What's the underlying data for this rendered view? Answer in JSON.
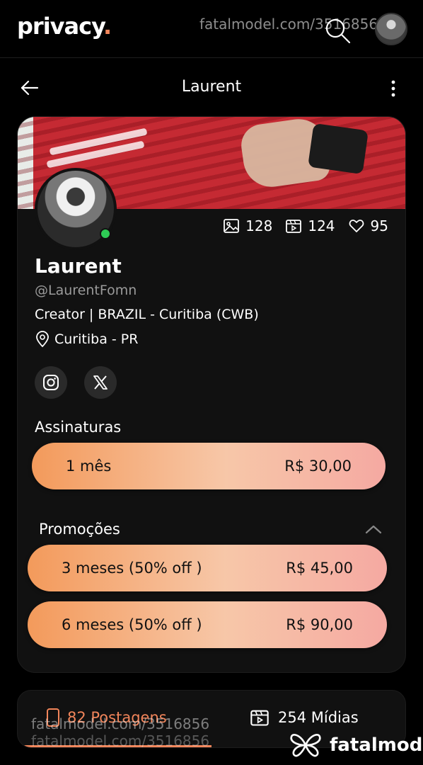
{
  "header": {
    "logo": "privacy",
    "logo_dot": ".",
    "watermark": "fatalmodel.com/3516856"
  },
  "nav": {
    "title": "Laurent"
  },
  "profile": {
    "name": "Laurent",
    "handle": "@LaurentFomn",
    "bio": "Creator | BRAZIL - Curitiba (CWB)",
    "location": "Curitiba - PR",
    "online_status_color": "#2ecc55"
  },
  "stats": {
    "images": "128",
    "videos": "124",
    "likes": "95"
  },
  "social": {
    "instagram_icon": "instagram-icon",
    "x_icon": "x-icon"
  },
  "subscriptions": {
    "title": "Assinaturas",
    "plans": [
      {
        "label": "1 mês",
        "price": "R$ 30,00"
      }
    ]
  },
  "promotions": {
    "title": "Promoções",
    "plans": [
      {
        "label": "3 meses (50% off )",
        "price": "R$ 45,00"
      },
      {
        "label": "6 meses (50% off )",
        "price": "R$ 90,00"
      }
    ]
  },
  "tabs": {
    "posts": "82 Postagens",
    "media": "254 Mídias"
  },
  "footer": {
    "watermark": "fatalmodel.com/3516856",
    "brand": "fatalmodel"
  },
  "colors": {
    "accent": "#f2855a",
    "background": "#000000",
    "card": "#111111"
  }
}
